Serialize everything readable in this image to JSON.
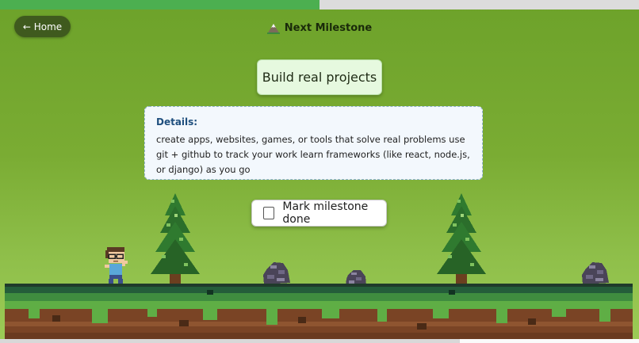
{
  "progress": {
    "fraction": 0.5
  },
  "nav": {
    "home_label": "← Home"
  },
  "header": {
    "title": "Next Milestone",
    "icon": "mountain-icon"
  },
  "milestone": {
    "title": "Build real projects"
  },
  "details": {
    "heading": "Details:",
    "text": "create apps, websites, games, or tools that solve real problems use git + github to track your work learn frameworks (like react, node.js, or django) as you go"
  },
  "done_toggle": {
    "label": "Mark milestone done",
    "checked": false
  },
  "colors": {
    "progress_fill": "#4caf50",
    "sky_top": "#6da22a",
    "home_button": "#3f5a1e",
    "details_heading": "#1f4f7e"
  },
  "sprites": [
    "player-character",
    "pine-tree",
    "pine-tree",
    "rock",
    "rock",
    "rock"
  ]
}
